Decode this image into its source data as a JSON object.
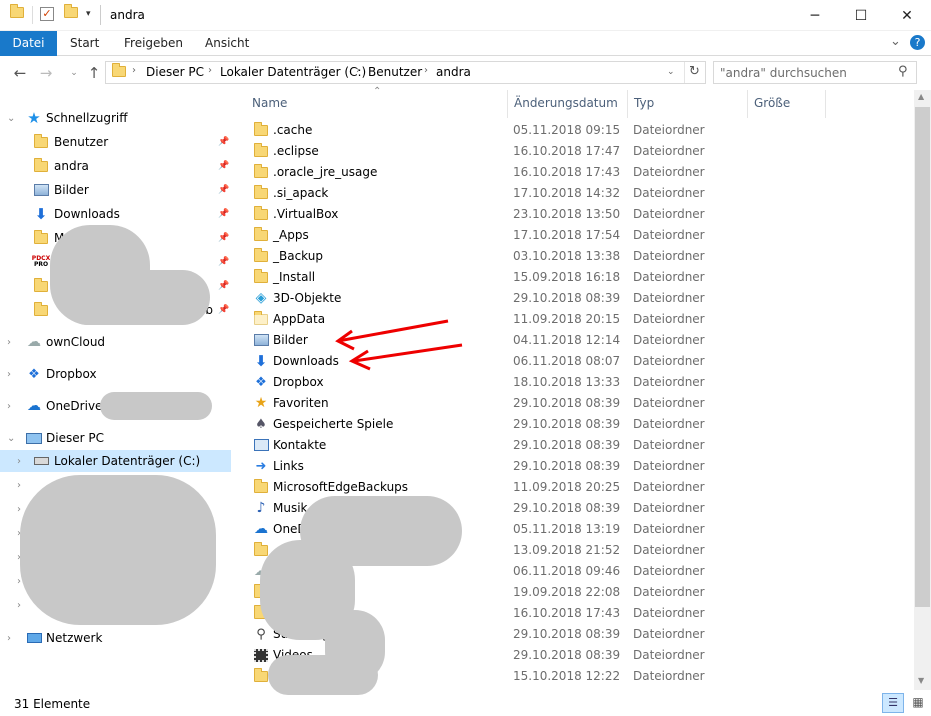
{
  "window": {
    "title": "andra",
    "minimize": "─",
    "maximize": "☐",
    "close": "✕"
  },
  "ribbon": {
    "tabs": [
      "Datei",
      "Start",
      "Freigeben",
      "Ansicht"
    ],
    "expand": "⌄",
    "help": "?"
  },
  "address": {
    "crumbs": [
      "Dieser PC",
      "Lokaler Datenträger (C:)",
      "Benutzer",
      "andra"
    ],
    "refresh": "↻"
  },
  "search": {
    "placeholder": "\"andra\" durchsuchen"
  },
  "nav": {
    "quick_access": "Schnellzugriff",
    "quick_items": [
      {
        "label": "Benutzer",
        "icon": "folder-icon"
      },
      {
        "label": "andra",
        "icon": "folder-icon"
      },
      {
        "label": "Bilder",
        "icon": "pictures-icon"
      },
      {
        "label": "Downloads",
        "icon": "download-icon"
      },
      {
        "label": "M",
        "icon": "folder-icon"
      },
      {
        "label": "",
        "icon": "pdf-icon"
      },
      {
        "label": "",
        "icon": "folder-icon"
      },
      {
        "label": "ab",
        "icon": "folder-icon"
      }
    ],
    "owncloud": "ownCloud",
    "dropbox": "Dropbox",
    "onedrive": "OneDrive",
    "this_pc": "Dieser PC",
    "local_disk": "Lokaler Datenträger (C:)",
    "network": "Netzwerk"
  },
  "columns": {
    "name": "Name",
    "date": "Änderungsdatum",
    "type": "Typ",
    "size": "Größe"
  },
  "files": [
    {
      "name": ".cache",
      "date": "05.11.2018 09:15",
      "type": "Dateiordner",
      "icon": "folder-icon"
    },
    {
      "name": ".eclipse",
      "date": "16.10.2018 17:47",
      "type": "Dateiordner",
      "icon": "folder-icon"
    },
    {
      "name": ".oracle_jre_usage",
      "date": "16.10.2018 17:43",
      "type": "Dateiordner",
      "icon": "folder-icon"
    },
    {
      "name": ".si_apack",
      "date": "17.10.2018 14:32",
      "type": "Dateiordner",
      "icon": "folder-icon"
    },
    {
      "name": ".VirtualBox",
      "date": "23.10.2018 13:50",
      "type": "Dateiordner",
      "icon": "folder-icon"
    },
    {
      "name": "_Apps",
      "date": "17.10.2018 17:54",
      "type": "Dateiordner",
      "icon": "folder-icon"
    },
    {
      "name": "_Backup",
      "date": "03.10.2018 13:38",
      "type": "Dateiordner",
      "icon": "folder-icon"
    },
    {
      "name": "_Install",
      "date": "15.09.2018 16:18",
      "type": "Dateiordner",
      "icon": "folder-icon"
    },
    {
      "name": "3D-Objekte",
      "date": "29.10.2018 08:39",
      "type": "Dateiordner",
      "icon": "cube-icon"
    },
    {
      "name": "AppData",
      "date": "11.09.2018 20:15",
      "type": "Dateiordner",
      "icon": "folder-light-icon"
    },
    {
      "name": "Bilder",
      "date": "04.11.2018 12:14",
      "type": "Dateiordner",
      "icon": "pictures-icon"
    },
    {
      "name": "Downloads",
      "date": "06.11.2018 08:07",
      "type": "Dateiordner",
      "icon": "download-icon"
    },
    {
      "name": "Dropbox",
      "date": "18.10.2018 13:33",
      "type": "Dateiordner",
      "icon": "dropbox-icon"
    },
    {
      "name": "Favoriten",
      "date": "29.10.2018 08:39",
      "type": "Dateiordner",
      "icon": "star-icon"
    },
    {
      "name": "Gespeicherte Spiele",
      "date": "29.10.2018 08:39",
      "type": "Dateiordner",
      "icon": "games-icon"
    },
    {
      "name": "Kontakte",
      "date": "29.10.2018 08:39",
      "type": "Dateiordner",
      "icon": "contacts-icon"
    },
    {
      "name": "Links",
      "date": "29.10.2018 08:39",
      "type": "Dateiordner",
      "icon": "link-icon"
    },
    {
      "name": "MicrosoftEdgeBackups",
      "date": "11.09.2018 20:25",
      "type": "Dateiordner",
      "icon": "folder-icon"
    },
    {
      "name": "Musik",
      "date": "29.10.2018 08:39",
      "type": "Dateiordner",
      "icon": "music-icon"
    },
    {
      "name": "OneDri",
      "date": "05.11.2018 13:19",
      "type": "Dateiordner",
      "icon": "onedrive-icon"
    },
    {
      "name": "",
      "date": "13.09.2018 21:52",
      "type": "Dateiordner",
      "icon": "folder-icon"
    },
    {
      "name": "",
      "date": "06.11.2018 09:46",
      "type": "Dateiordner",
      "icon": "cloud-icon"
    },
    {
      "name": "",
      "date": "19.09.2018 22:08",
      "type": "Dateiordner",
      "icon": "folder-icon"
    },
    {
      "name": "",
      "date": "16.10.2018 17:43",
      "type": "Dateiordner",
      "icon": "folder-icon"
    },
    {
      "name": "Suchvorgäng",
      "date": "29.10.2018 08:39",
      "type": "Dateiordner",
      "icon": "search-icon"
    },
    {
      "name": "Videos",
      "date": "29.10.2018 08:39",
      "type": "Dateiordner",
      "icon": "video-icon"
    },
    {
      "name": "",
      "date": "15.10.2018 12:22",
      "type": "Dateiordner",
      "icon": "folder-icon"
    }
  ],
  "status": {
    "count": "31 Elemente"
  }
}
